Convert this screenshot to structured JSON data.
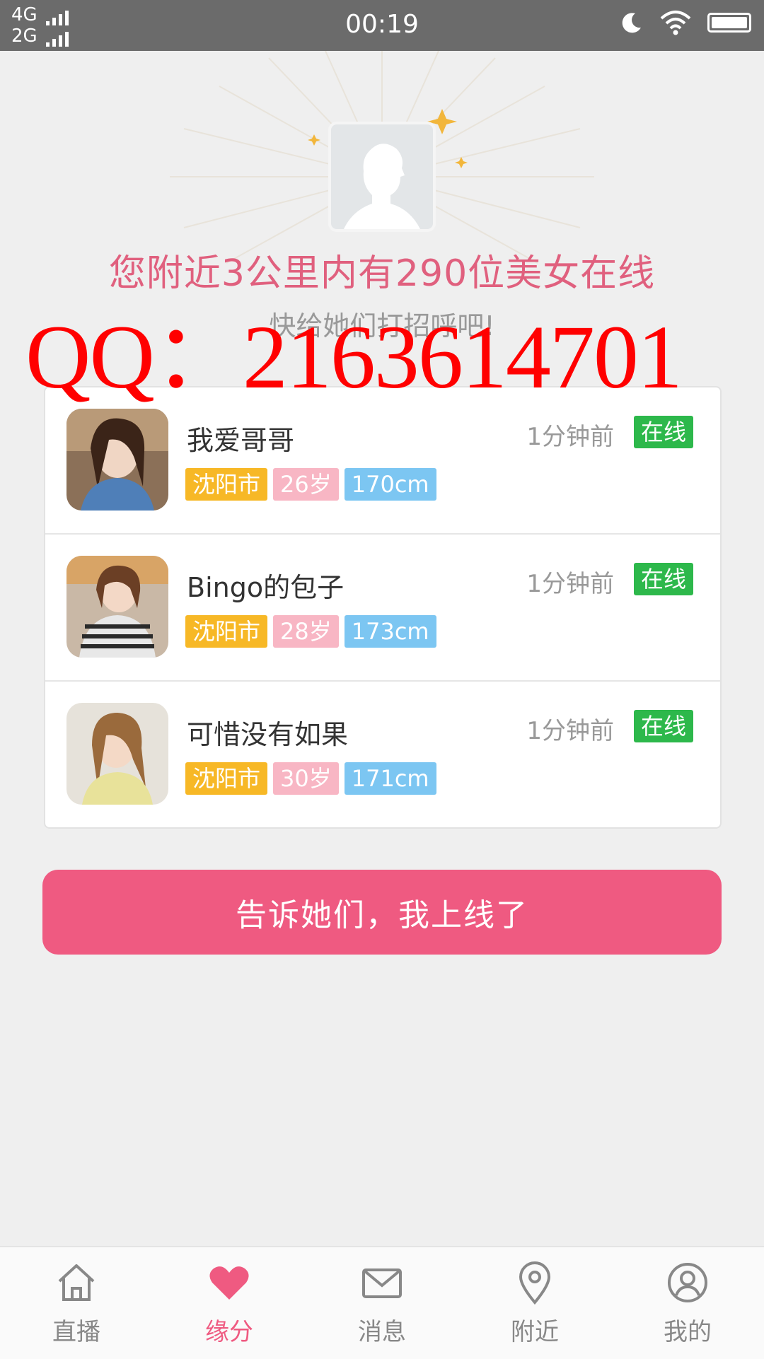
{
  "status_bar": {
    "network_1": "4G",
    "network_2": "2G",
    "time": "00:19"
  },
  "hero": {
    "headline": "您附近3公里内有290位美女在线",
    "subline": "快给她们打招呼吧!"
  },
  "watermark": "QQ：2163614701",
  "users": [
    {
      "name": "我爱哥哥",
      "time": "1分钟前",
      "status": "在线",
      "city": "沈阳市",
      "age": "26岁",
      "height": "170cm"
    },
    {
      "name": "Bingo的包子",
      "time": "1分钟前",
      "status": "在线",
      "city": "沈阳市",
      "age": "28岁",
      "height": "173cm"
    },
    {
      "name": "可惜没有如果",
      "time": "1分钟前",
      "status": "在线",
      "city": "沈阳市",
      "age": "30岁",
      "height": "171cm"
    }
  ],
  "cta": {
    "label": "告诉她们，我上线了"
  },
  "tabbar": {
    "tabs": [
      {
        "label": "直播",
        "icon": "home-icon"
      },
      {
        "label": "缘分",
        "icon": "heart-icon",
        "active": true
      },
      {
        "label": "消息",
        "icon": "mail-icon"
      },
      {
        "label": "附近",
        "icon": "location-pin-icon"
      },
      {
        "label": "我的",
        "icon": "user-icon"
      }
    ]
  },
  "colors": {
    "accent": "#ef5a81",
    "online": "#2db84b",
    "tag_city": "#f7b826",
    "tag_age": "#f8b6c4",
    "tag_height": "#7cc6f2"
  }
}
